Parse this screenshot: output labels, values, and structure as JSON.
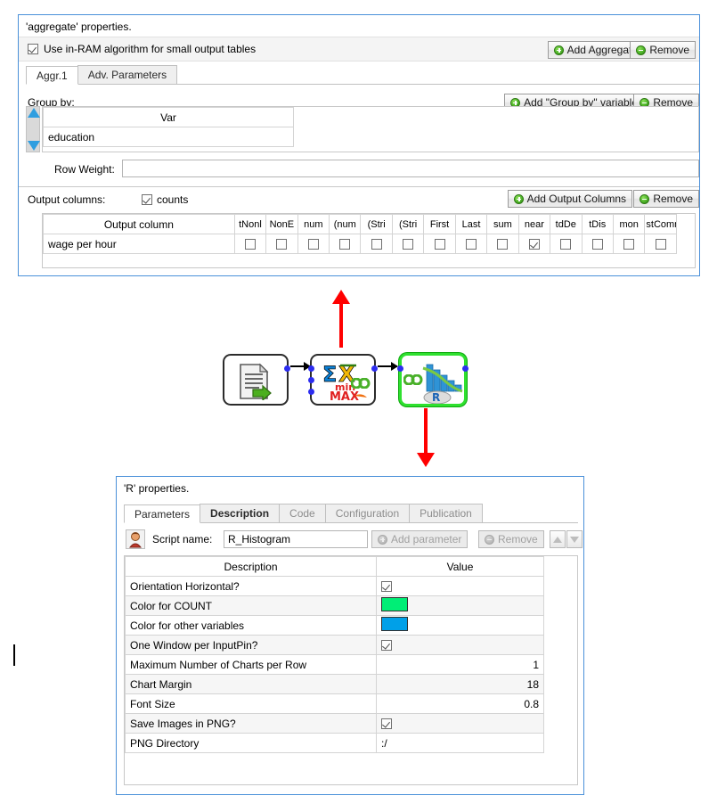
{
  "aggregate_panel": {
    "title": "'aggregate' properties.",
    "inram_checkbox": {
      "label": "Use in-RAM algorithm for small output tables",
      "checked": true
    },
    "buttons": {
      "add_aggregate": "Add Aggregate",
      "remove_top": "Remove"
    },
    "tabs": [
      {
        "label": "Aggr.1",
        "active": true
      },
      {
        "label": "Adv. Parameters",
        "active": false
      }
    ],
    "group_by": {
      "label": "Group by:",
      "add_button": "Add \"Group by\" variable",
      "remove_button": "Remove",
      "column_header": "Var",
      "rows": [
        "education"
      ]
    },
    "row_weight": {
      "label": "Row Weight:",
      "value": ""
    },
    "output_columns": {
      "label": "Output columns:",
      "counts_checkbox": {
        "label": "counts",
        "checked": true
      },
      "add_button": "Add Output Columns",
      "remove_button": "Remove",
      "first_col_header": "Output column",
      "check_headers": [
        "tNonl",
        "NonE",
        "num",
        "(num",
        "(Stri",
        "(Stri",
        "First",
        "Last",
        "sum",
        "near",
        "tdDe",
        "tDis",
        "mon",
        "stCommon"
      ],
      "rows": [
        {
          "name": "wage per hour",
          "checks": [
            false,
            false,
            false,
            false,
            false,
            false,
            false,
            false,
            false,
            true,
            false,
            false,
            false,
            false
          ]
        }
      ]
    }
  },
  "workflow": {
    "nodes": [
      {
        "name": "file-reader-node",
        "selected": false
      },
      {
        "name": "aggregate-node",
        "selected": false
      },
      {
        "name": "r-histogram-node",
        "selected": true
      }
    ],
    "node_labels": {
      "aggregate_min": "min",
      "aggregate_max": "MAX",
      "r_letter": "R"
    }
  },
  "r_panel": {
    "title": "'R' properties.",
    "tabs": [
      {
        "label": "Parameters",
        "state": "active"
      },
      {
        "label": "Description",
        "state": "bold"
      },
      {
        "label": "Code",
        "state": "muted"
      },
      {
        "label": "Configuration",
        "state": "muted"
      },
      {
        "label": "Publication",
        "state": "muted"
      }
    ],
    "script_row": {
      "icon": "script-person-icon",
      "label": "Script name:",
      "value": "R_Histogram",
      "add_parameter_button": "Add parameter",
      "remove_button": "Remove"
    },
    "table": {
      "headers": [
        "Description",
        "Value"
      ],
      "rows": [
        {
          "description": "Orientation Horizontal?",
          "type": "check",
          "checked": true,
          "value": ""
        },
        {
          "description": "Color for COUNT",
          "type": "color",
          "color": "#00ee76",
          "value": ""
        },
        {
          "description": "Color for other variables",
          "type": "color",
          "color": "#00a0e8",
          "value": ""
        },
        {
          "description": "One Window per InputPin?",
          "type": "check",
          "checked": true,
          "value": ""
        },
        {
          "description": "Maximum Number of Charts per Row",
          "type": "number",
          "value": "1"
        },
        {
          "description": "Chart Margin",
          "type": "number",
          "value": "18"
        },
        {
          "description": "Font Size",
          "type": "number",
          "value": "0.8"
        },
        {
          "description": "Save Images in PNG?",
          "type": "check",
          "checked": true,
          "value": ""
        },
        {
          "description": "PNG Directory",
          "type": "text",
          "value": ":/"
        }
      ]
    }
  },
  "colors": {
    "panel_border": "#4a90d9",
    "arrow": "#ff0000",
    "node_selected": "#2fe02f",
    "count_color": "#00ee76",
    "other_color": "#00a0e8"
  }
}
